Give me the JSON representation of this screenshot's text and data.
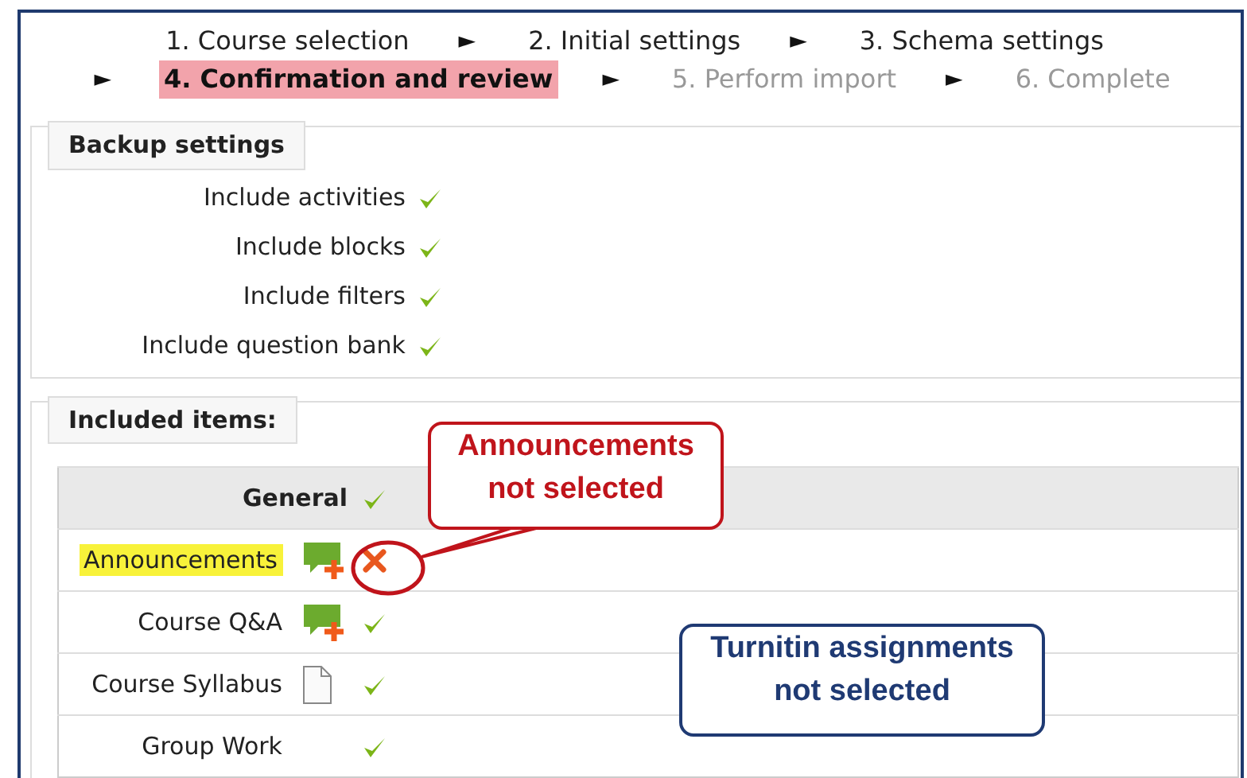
{
  "steps": [
    {
      "kind": "step",
      "label": "1. Course selection",
      "selected": false,
      "disabled": false
    },
    {
      "kind": "arrow",
      "label": "►"
    },
    {
      "kind": "step",
      "label": "2. Initial settings",
      "selected": false,
      "disabled": false
    },
    {
      "kind": "arrow",
      "label": "►"
    },
    {
      "kind": "step",
      "label": "3. Schema settings",
      "selected": false,
      "disabled": false
    },
    {
      "kind": "arrow",
      "label": "►"
    },
    {
      "kind": "step",
      "label": "4. Confirmation and review",
      "selected": true,
      "disabled": false
    },
    {
      "kind": "arrow",
      "label": "►"
    },
    {
      "kind": "step",
      "label": "5. Perform import",
      "selected": false,
      "disabled": true
    },
    {
      "kind": "arrow",
      "label": "►"
    },
    {
      "kind": "step",
      "label": "6. Complete",
      "selected": false,
      "disabled": true
    }
  ],
  "backup_settings": {
    "legend": "Backup settings",
    "items": [
      {
        "label": "Include activities",
        "included": true
      },
      {
        "label": "Include blocks",
        "included": true
      },
      {
        "label": "Include filters",
        "included": true
      },
      {
        "label": "Include question bank",
        "included": true
      }
    ]
  },
  "included_items": {
    "legend": "Included items:",
    "section": {
      "label": "General",
      "included": true
    },
    "items": [
      {
        "label": "Announcements",
        "kind": "forum",
        "included": false,
        "highlighted": true
      },
      {
        "label": "Course Q&A",
        "kind": "forum",
        "included": true,
        "highlighted": false
      },
      {
        "label": "Course Syllabus",
        "kind": "file",
        "included": true,
        "highlighted": false
      },
      {
        "label": "Group Work",
        "kind": "plain",
        "included": true,
        "highlighted": false
      }
    ]
  },
  "callouts": [
    {
      "kind": "pointer",
      "text": "Announcements\nnot selected",
      "color": "#c0141b"
    },
    {
      "kind": "box",
      "text": "Turnitin assignments\nnot selected",
      "color": "#1f3a73"
    }
  ]
}
